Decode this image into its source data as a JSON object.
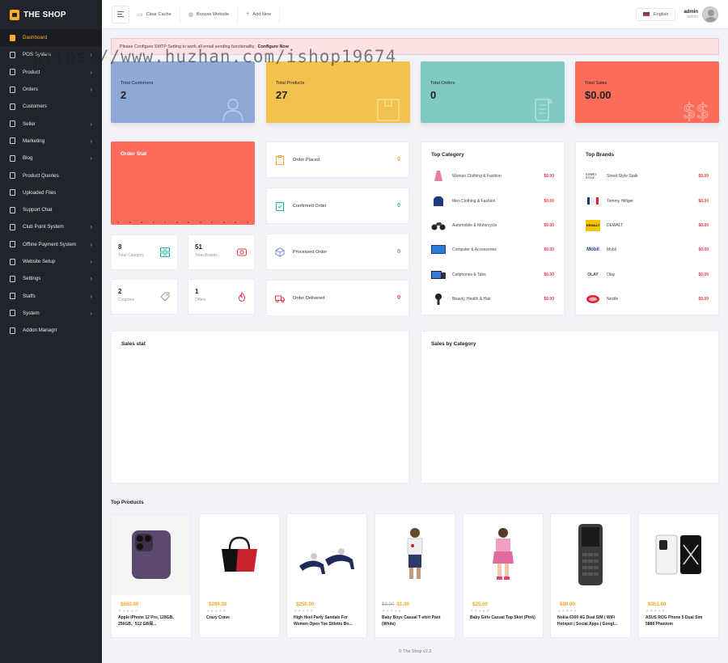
{
  "brand": {
    "name": "THE SHOP"
  },
  "sidebar": {
    "items": [
      {
        "label": "Dashboard",
        "active": true,
        "chevron": false
      },
      {
        "label": "POS System",
        "chevron": true
      },
      {
        "label": "Product",
        "chevron": true
      },
      {
        "label": "Orders",
        "chevron": true
      },
      {
        "label": "Customers",
        "chevron": false
      },
      {
        "label": "Seller",
        "chevron": true
      },
      {
        "label": "Marketing",
        "chevron": true
      },
      {
        "label": "Blog",
        "chevron": true
      },
      {
        "label": "Product Queries",
        "chevron": false
      },
      {
        "label": "Uploaded Files",
        "chevron": false
      },
      {
        "label": "Support Chat",
        "chevron": false
      },
      {
        "label": "Club Point System",
        "chevron": true
      },
      {
        "label": "Offline Payment System",
        "chevron": true
      },
      {
        "label": "Website Setup",
        "chevron": true
      },
      {
        "label": "Settings",
        "chevron": true
      },
      {
        "label": "Staffs",
        "chevron": true
      },
      {
        "label": "System",
        "chevron": true
      },
      {
        "label": "Addon Managrr",
        "chevron": false
      }
    ]
  },
  "topbar": {
    "clear_cache": "Clear Cache",
    "browse_website": "Browse Website",
    "add_new": "Add New",
    "language": "English",
    "user_name": "admin",
    "user_role": "admin"
  },
  "alert": {
    "message": "Please Configure SMTP Setting to work all email sending functionality,",
    "link": "Configure Now"
  },
  "watermark": "https://www.huzhan.com/ishop19674",
  "stats": [
    {
      "label": "Total Customers",
      "value": "2",
      "color": "#8fa8d8"
    },
    {
      "label": "Total Products",
      "value": "27",
      "color": "#f2c14e"
    },
    {
      "label": "Total Orders",
      "value": "0",
      "color": "#7fcac3"
    },
    {
      "label": "Total Sales",
      "value": "$0.00",
      "color": "#fb6c5b"
    }
  ],
  "order_stat": {
    "title": "Order Stat"
  },
  "mini_stats": [
    {
      "value": "8",
      "label": "Total Category"
    },
    {
      "value": "51",
      "label": "Total Brands"
    },
    {
      "value": "2",
      "label": "Coupons"
    },
    {
      "value": "1",
      "label": "Offers"
    }
  ],
  "orders": [
    {
      "label": "Order Placed",
      "value": "0",
      "color": "#f5a623"
    },
    {
      "label": "Confirmed Order",
      "value": "0",
      "color": "#2bb5a0"
    },
    {
      "label": "Processed Order",
      "value": "0",
      "color": "#7b8bd8"
    },
    {
      "label": "Order Delivered",
      "value": "0",
      "color": "#e8394d"
    }
  ],
  "top_category": {
    "title": "Top Category",
    "items": [
      {
        "name": "Women Clothing & Fashion",
        "price": "$0.00"
      },
      {
        "name": "Men Clothing & Fashion",
        "price": "$0.00"
      },
      {
        "name": "Automobile & Motorcycle",
        "price": "$0.00"
      },
      {
        "name": "Computer & Accessories",
        "price": "$0.00"
      },
      {
        "name": "Cellphones & Tabs",
        "price": "$0.00"
      },
      {
        "name": "Beauty, Health & Hair",
        "price": "$0.00"
      }
    ]
  },
  "top_brands": {
    "title": "Top Brands",
    "items": [
      {
        "name": "Street Style Stalk",
        "price": "$0.00",
        "logo": "STREET STYLE"
      },
      {
        "name": "Tommy Hilfiger",
        "price": "$0.00",
        "logo": ""
      },
      {
        "name": "DEWALT",
        "price": "$0.00",
        "logo": "DEWALT"
      },
      {
        "name": "Mobil",
        "price": "$0.00",
        "logo": "Mobil"
      },
      {
        "name": "Olay",
        "price": "$0.00",
        "logo": "OLAY"
      },
      {
        "name": "Nestle",
        "price": "$0.00",
        "logo": ""
      }
    ]
  },
  "charts": {
    "sales_stat": "Sales stat",
    "sales_by_category": "Sales by Category"
  },
  "top_products": {
    "title": "Top Products",
    "items": [
      {
        "price": "$650.00",
        "old_price": "",
        "name": "Apple iPhone 12 Pro, 128GB、256GB、512 GB深...",
        "stars": "★★★★★"
      },
      {
        "price": "$299.00",
        "old_price": "",
        "name": "Crazy Crave",
        "stars": "★★★★★"
      },
      {
        "price": "$250.00",
        "old_price": "",
        "name": "High Heel Party Sandals For Women Open Toe Stiletto Bo...",
        "stars": "★★★★★"
      },
      {
        "price": "$1.00",
        "old_price": "$3.00",
        "name": "Baby Boys Casual T-shirt Pant (White)",
        "stars": "★★★★★"
      },
      {
        "price": "$25.00",
        "old_price": "",
        "name": "Baby Girls Casual Top Skirt (Pink)",
        "stars": "★★★★★"
      },
      {
        "price": "$80.00",
        "old_price": "",
        "name": "Nokia 6300 4G Dual SIM | WiFi Hotspot | Social Apps | Googl...",
        "stars": "★★★★★"
      },
      {
        "price": "$351.00",
        "old_price": "",
        "name": "ASUS ROG Phone 5 Dual Sim 5888 Phantom",
        "stars": "★★★★★"
      }
    ]
  },
  "footer": "© The Shop v2.2"
}
